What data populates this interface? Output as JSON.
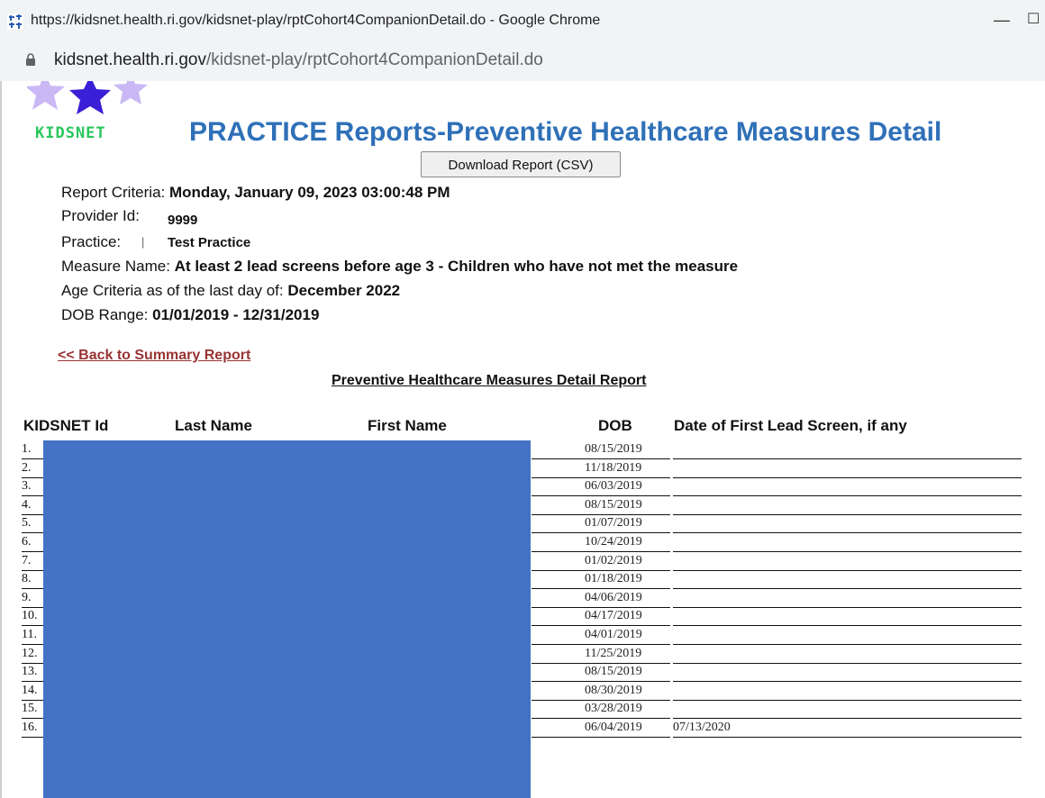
{
  "browser": {
    "window_title": "https://kidsnet.health.ri.gov/kidsnet-play/rptCohort4CompanionDetail.do - Google Chrome",
    "minimize_glyph": "—",
    "maximize_glyph": "☐",
    "url_host": "kidsnet.health.ri.gov",
    "url_path": "/kidsnet-play/rptCohort4CompanionDetail.do"
  },
  "logo": {
    "text": "KIDSNET"
  },
  "header": {
    "title": "PRACTICE Reports-Preventive Healthcare Measures Detail",
    "download_label": "Download Report (CSV)"
  },
  "criteria": {
    "report_label": "Report Criteria:",
    "report_value": "Monday, January 09, 2023 03:00:48 PM",
    "provider_label": "Provider Id:",
    "provider_value": "9999",
    "practice_label": "Practice:",
    "practice_sep": "|",
    "practice_value": "Test Practice",
    "measure_label": "Measure Name:",
    "measure_value": "At least 2 lead screens before age 3 - Children who have not met the measure",
    "age_label": "Age Criteria as of the last day of:",
    "age_value": "December 2022",
    "dob_label": "DOB Range:",
    "dob_value": "01/01/2019 - 12/31/2019"
  },
  "nav": {
    "back_link": "<< Back to Summary Report"
  },
  "report": {
    "subtitle": "Preventive Healthcare Measures Detail Report"
  },
  "table": {
    "headers": [
      "KIDSNET Id",
      "Last Name",
      "First Name",
      "DOB",
      "Date of First Lead Screen, if any"
    ],
    "rows": [
      {
        "num": "1.",
        "dob": "08/15/2019",
        "lead": ""
      },
      {
        "num": "2.",
        "dob": "11/18/2019",
        "lead": ""
      },
      {
        "num": "3.",
        "dob": "06/03/2019",
        "lead": ""
      },
      {
        "num": "4.",
        "dob": "08/15/2019",
        "lead": ""
      },
      {
        "num": "5.",
        "dob": "01/07/2019",
        "lead": ""
      },
      {
        "num": "6.",
        "dob": "10/24/2019",
        "lead": ""
      },
      {
        "num": "7.",
        "dob": "01/02/2019",
        "lead": ""
      },
      {
        "num": "8.",
        "dob": "01/18/2019",
        "lead": ""
      },
      {
        "num": "9.",
        "dob": "04/06/2019",
        "lead": ""
      },
      {
        "num": "10.",
        "dob": "04/17/2019",
        "lead": ""
      },
      {
        "num": "11.",
        "dob": "04/01/2019",
        "lead": ""
      },
      {
        "num": "12.",
        "dob": "11/25/2019",
        "lead": ""
      },
      {
        "num": "13.",
        "dob": "08/15/2019",
        "lead": ""
      },
      {
        "num": "14.",
        "dob": "08/30/2019",
        "lead": ""
      },
      {
        "num": "15.",
        "dob": "03/28/2019",
        "lead": ""
      },
      {
        "num": "16.",
        "dob": "06/04/2019",
        "lead": "07/13/2020"
      }
    ]
  },
  "colors": {
    "title_blue": "#2f70b8",
    "link_red": "#993333",
    "logo_green": "#29c75d",
    "redaction_blue": "#4472c4",
    "star_dark": "#3a1fd6",
    "star_light": "#c9b8f5"
  }
}
